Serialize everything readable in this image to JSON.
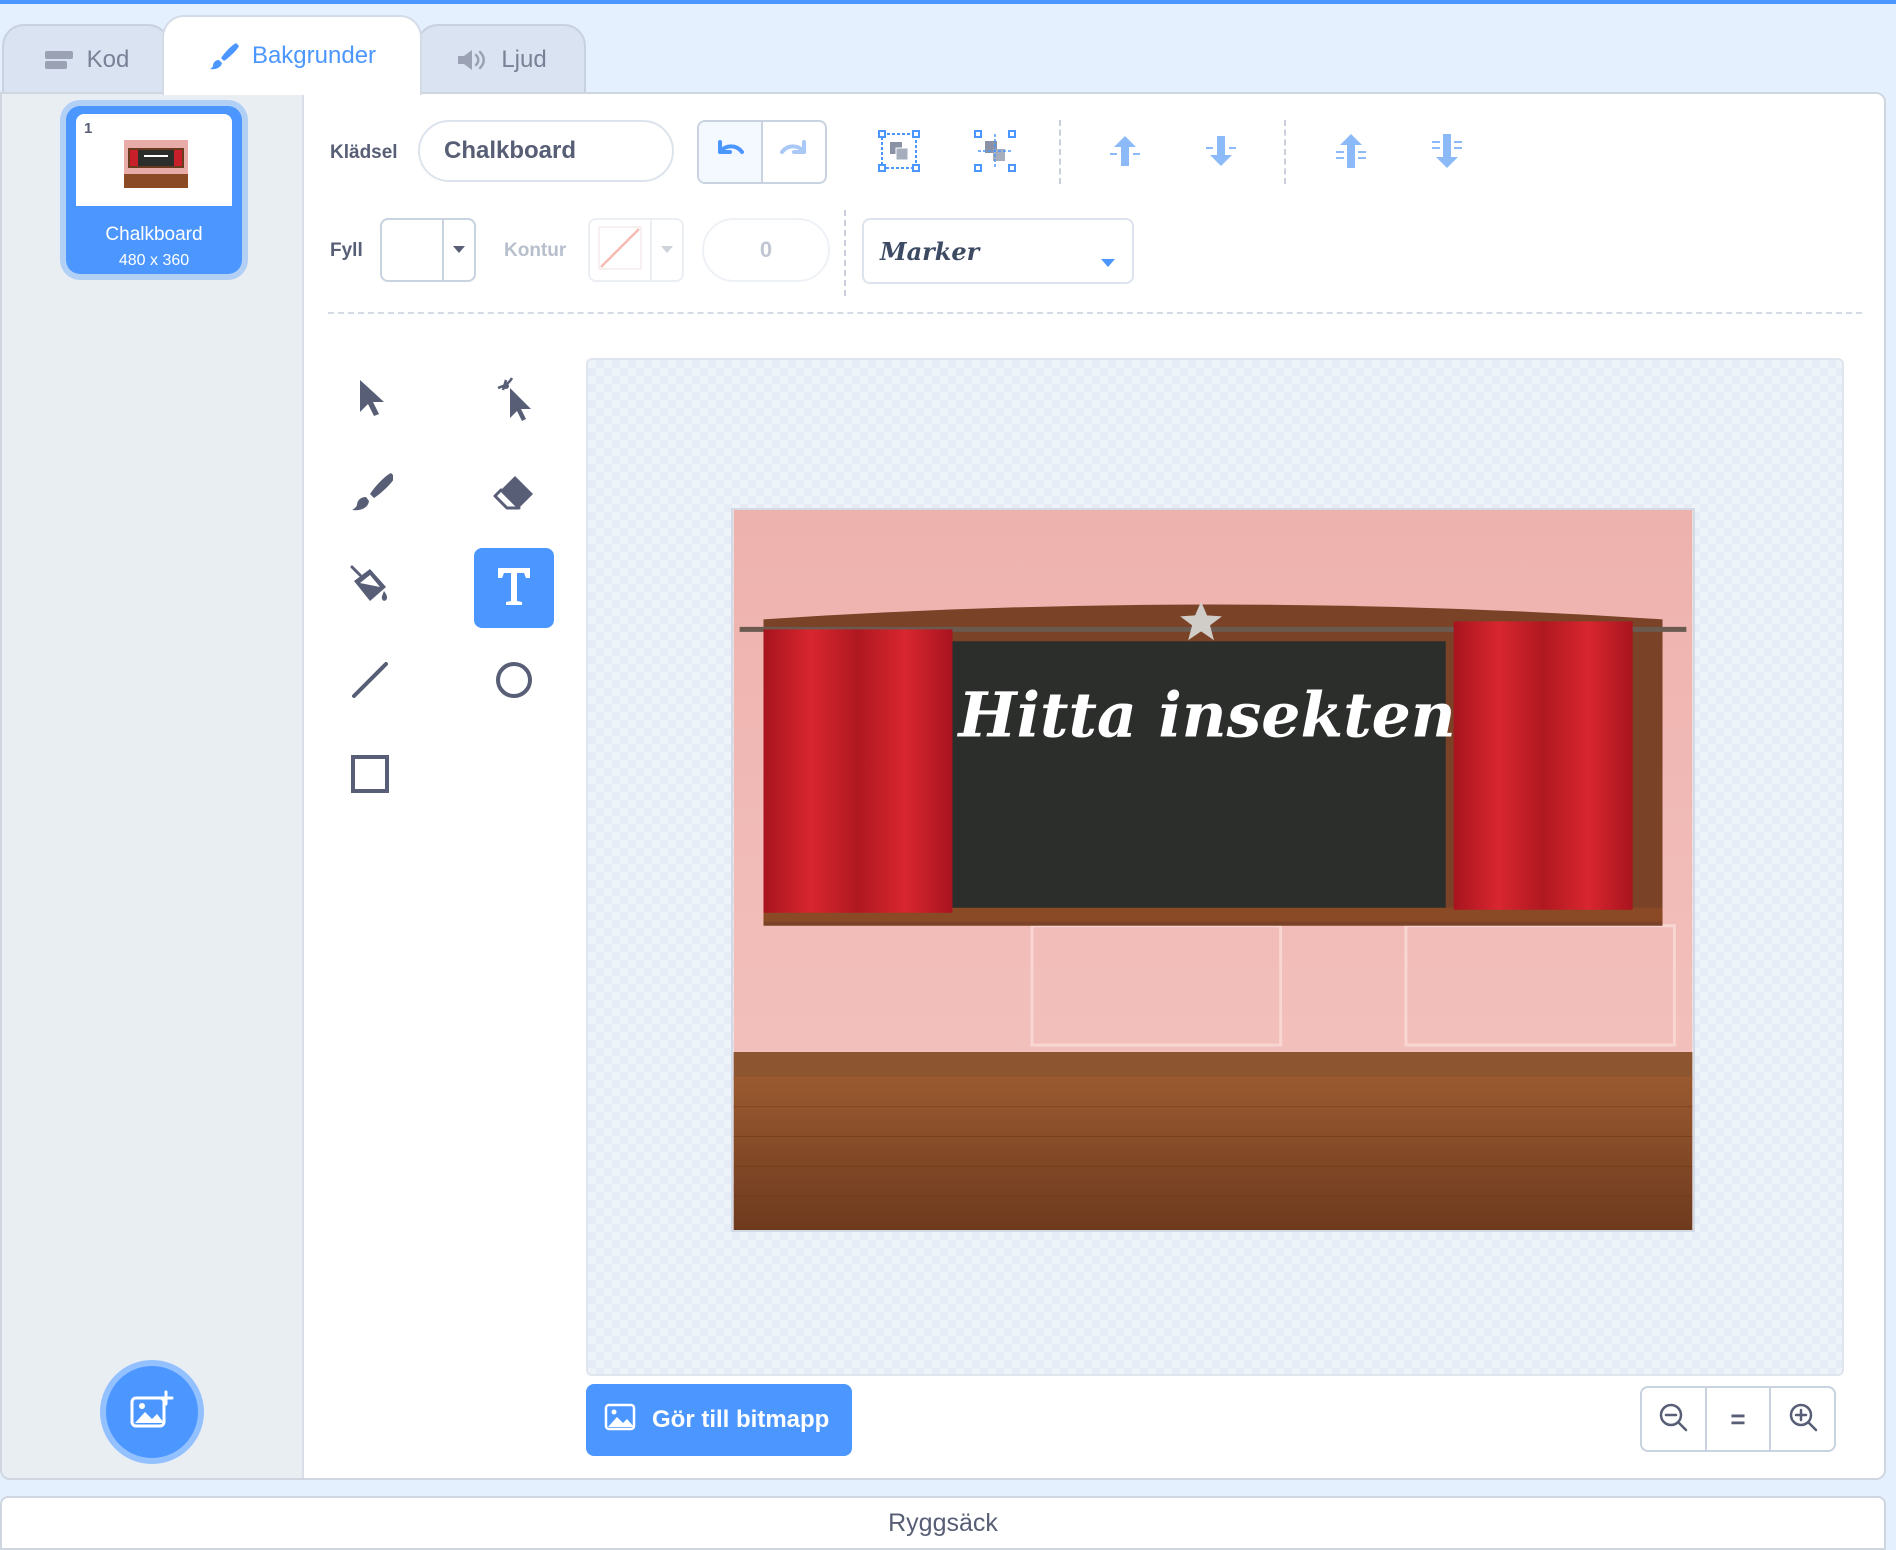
{
  "tabs": [
    {
      "label": "Kod",
      "icon": "code-icon"
    },
    {
      "label": "Bakgrunder",
      "icon": "paintbrush-icon",
      "active": true
    },
    {
      "label": "Ljud",
      "icon": "speaker-icon"
    }
  ],
  "backdrop_list": {
    "items": [
      {
        "number": "1",
        "name": "Chalkboard",
        "size": "480 x 360",
        "selected": true
      }
    ],
    "add_button_icon": "add-backdrop-icon"
  },
  "toolbar": {
    "costume_label": "Klädsel",
    "costume_name": "Chalkboard",
    "fill_label": "Fyll",
    "fill_color": "#ffffff",
    "outline_label": "Kontur",
    "outline_width": "0",
    "font": "Marker",
    "icons": [
      "undo-icon",
      "redo-icon",
      "group-icon",
      "ungroup-icon",
      "forward-icon",
      "backward-icon",
      "front-icon",
      "back-icon"
    ]
  },
  "tools": [
    "select-icon",
    "reshape-icon",
    "brush-icon",
    "eraser-icon",
    "fill-bucket-icon",
    "text-icon",
    "line-icon",
    "circle-icon",
    "rectangle-icon"
  ],
  "active_tool": "text-icon",
  "canvas": {
    "text": "Hitta insekten"
  },
  "bitmap_button": "Gör till bitmapp",
  "zoom": {
    "out_icon": "zoom-out-icon",
    "reset_label": "=",
    "in_icon": "zoom-in-icon"
  },
  "backpack": "Ryggsäck",
  "colors": {
    "accent": "#4c97ff",
    "curtain": "#c8202a",
    "wall": "#f0b8b4",
    "board": "#2c2e2c",
    "floor": "#8a4a26"
  }
}
